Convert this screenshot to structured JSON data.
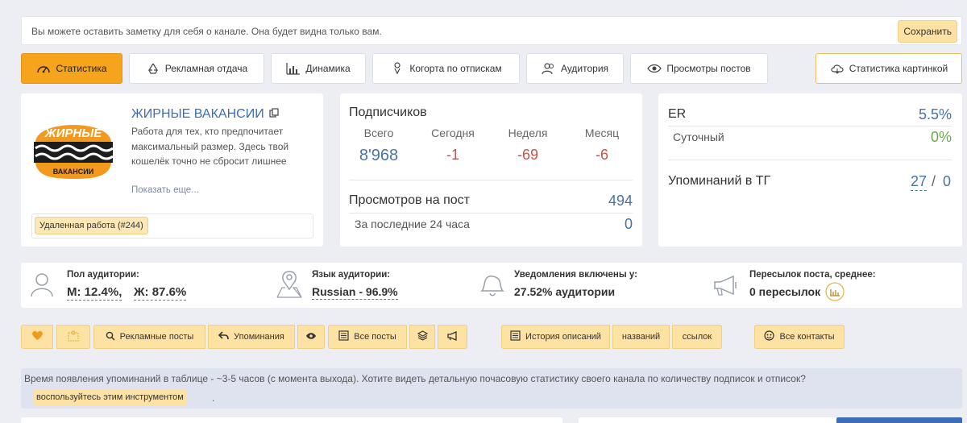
{
  "note": {
    "text": "Вы можете оставить заметку для себя о канале. Она будет видна только вам.",
    "save_label": "Сохранить"
  },
  "tabs": [
    {
      "label": "Статистика",
      "icon": "gauge-icon"
    },
    {
      "label": "Рекламная отдача",
      "icon": "recycle-icon"
    },
    {
      "label": "Динамика",
      "icon": "bar-chart-icon"
    },
    {
      "label": "Когорта по отпискам",
      "icon": "funnel-icon"
    },
    {
      "label": "Аудитория",
      "icon": "people-icon"
    },
    {
      "label": "Просмотры постов",
      "icon": "eye-icon"
    },
    {
      "label": "Статистика картинкой",
      "icon": "cloud-icon"
    }
  ],
  "channel": {
    "title": "ЖИРНЫЕ ВАКАНСИИ",
    "logo_text_top": "ЖИРНЫЕ",
    "logo_text_bottom": "ВАКАНСИИ",
    "description": "Работа для тех, кто предпочитает максимальный размер. Здесь твой кошелёк точно не сбросит лишнее",
    "show_more": "Показать еще...",
    "tag": "Удаленная работа (#244)"
  },
  "subscribers": {
    "title": "Подписчиков",
    "headers": [
      "Всего",
      "Сегодня",
      "Неделя",
      "Месяц"
    ],
    "values": [
      "8'968",
      "-1",
      "-69",
      "-6"
    ],
    "views_label": "Просмотров на пост",
    "views_value": "494",
    "last24_label": "За последние 24 часа",
    "last24_value": "0"
  },
  "er": {
    "label": "ER",
    "value": "5.5%",
    "daily_label": "Суточный",
    "daily_value": "0%",
    "mentions_label": "Упоминаний в ТГ",
    "mentions_value": "27",
    "mentions_sep": "/",
    "mentions_value2": "0"
  },
  "audience": {
    "gender_title": "Пол аудитории:",
    "gender_m": "М: 12.4%,",
    "gender_f": "Ж: 87.6%",
    "lang_title": "Язык аудитории:",
    "lang_value": "Russian - 96.9%",
    "notif_title": "Уведомления включены у:",
    "notif_value": "27.52% аудитории",
    "fwd_title": "Пересылок поста, среднее:",
    "fwd_value": "0 пересылок"
  },
  "actions": {
    "ad_posts": "Рекламные посты",
    "mentions": "Упоминания",
    "all_posts": "Все посты",
    "history": "История описаний",
    "names": "названий",
    "links": "ссылок",
    "contacts": "Все контакты"
  },
  "info": {
    "text": "Время появления упоминаний в таблице - ~3-5 часов (с момента выхода). Хотите видеть детальную почасовую статистику своего канала по количеству подписок и отписок?",
    "button": "воспользуйтесь этим инструментом",
    "dot": "."
  },
  "colors": {
    "accent": "#f5a41c",
    "button_bg": "#fde2a4",
    "link_blue": "#4a72a9",
    "negative_red": "#c9514c",
    "positive_green": "#6ca84a"
  }
}
